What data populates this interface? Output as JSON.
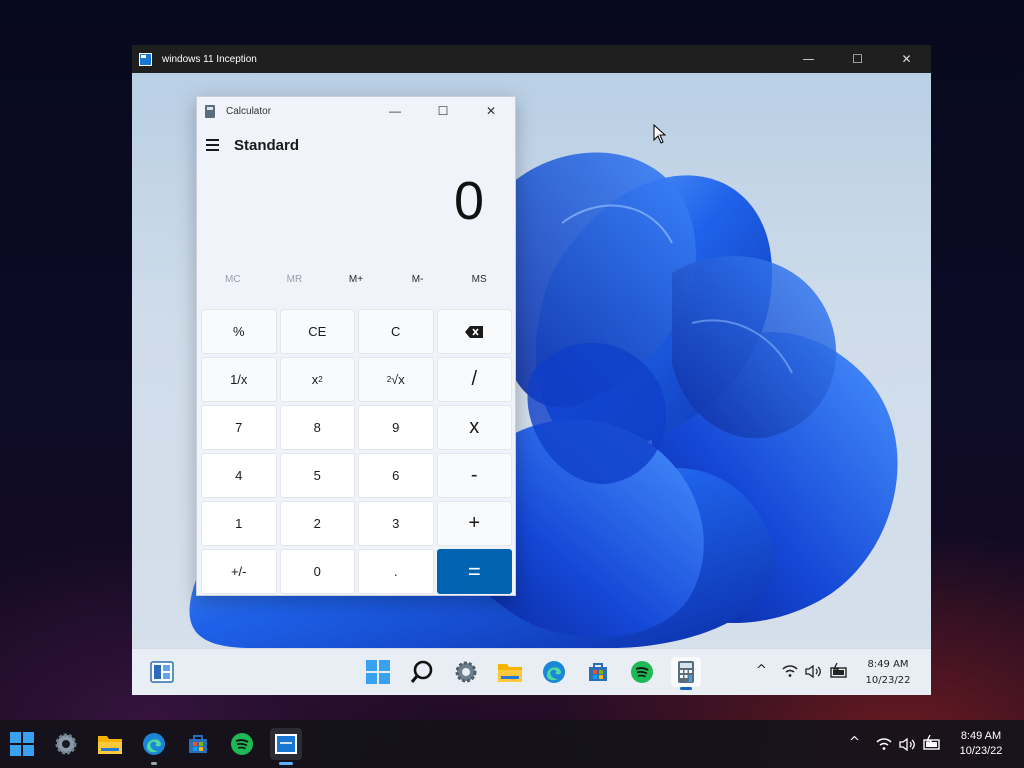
{
  "vm_window": {
    "title": "windows 11 Inception",
    "minimize": "—",
    "maximize": "☐",
    "close": "✕"
  },
  "calculator": {
    "title": "Calculator",
    "minimize": "—",
    "maximize": "☐",
    "close": "✕",
    "mode": "Standard",
    "display": "0",
    "memory": [
      "MC",
      "MR",
      "M+",
      "M-",
      "MS"
    ],
    "keys": {
      "percent": "%",
      "ce": "CE",
      "c": "C",
      "backspace": "⌫",
      "reciprocal": "1/x",
      "square_base": "x",
      "square_exp": "2",
      "sqrt_idx": "2",
      "sqrt_sym": "√x",
      "divide": "/",
      "seven": "7",
      "eight": "8",
      "nine": "9",
      "multiply": "x",
      "four": "4",
      "five": "5",
      "six": "6",
      "minus": "-",
      "one": "1",
      "two": "2",
      "three": "3",
      "plus": "+",
      "negate": "+/-",
      "zero": "0",
      "decimal": ".",
      "equals": "="
    }
  },
  "inner_taskbar": {
    "icons": [
      "start-icon",
      "search-icon",
      "settings-icon",
      "file-explorer-icon",
      "edge-icon",
      "store-icon",
      "spotify-icon",
      "calculator-icon"
    ],
    "tray": {
      "chevron": "^",
      "wifi": "wifi-icon",
      "volume": "volume-icon",
      "battery": "battery-icon"
    },
    "time": "8:49 AM",
    "date": "10/23/22"
  },
  "outer_taskbar": {
    "icons": [
      "start-icon",
      "settings-icon",
      "file-explorer-icon",
      "edge-icon",
      "store-icon",
      "spotify-icon",
      "vm-icon"
    ],
    "tray": {
      "chevron": "^",
      "wifi": "wifi-icon",
      "volume": "volume-icon",
      "battery": "battery-icon"
    },
    "time": "8:49 AM",
    "date": "10/23/22"
  },
  "colors": {
    "accent": "#0063b1",
    "bloom": "#1a5fe0"
  }
}
